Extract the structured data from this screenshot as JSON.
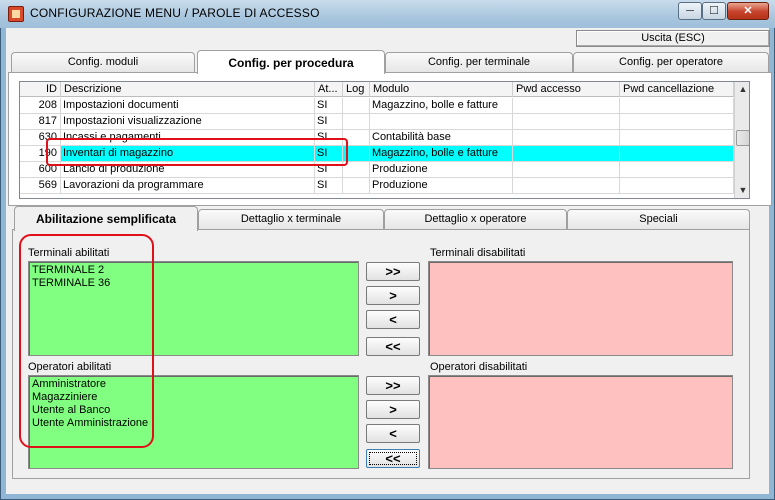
{
  "window": {
    "title": "CONFIGURAZIONE MENU / PAROLE DI ACCESSO",
    "min_glyph": "─",
    "max_glyph": "☐",
    "close_glyph": "✕",
    "icon": "app-icon"
  },
  "toolbar": {
    "exit_label": "Uscita (ESC)"
  },
  "top_tabs": [
    {
      "label": "Config. moduli",
      "active": false
    },
    {
      "label": "Config. per procedura",
      "active": true
    },
    {
      "label": "Config. per terminale",
      "active": false
    },
    {
      "label": "Config. per operatore",
      "active": false
    }
  ],
  "table": {
    "headers": [
      "ID",
      "Descrizione",
      "At...",
      "Log",
      "Modulo",
      "Pwd accesso",
      "Pwd cancellazione"
    ],
    "rows": [
      {
        "id": "208",
        "descrizione": "Impostazioni documenti",
        "attivo": "SI",
        "log": "",
        "modulo": "Magazzino, bolle e fatture",
        "selected": false
      },
      {
        "id": "817",
        "descrizione": "Impostazioni visualizzazione",
        "attivo": "SI",
        "log": "",
        "modulo": "",
        "selected": false
      },
      {
        "id": "630",
        "descrizione": "Incassi e pagamenti",
        "attivo": "SI",
        "log": "",
        "modulo": "Contabilità base",
        "selected": false
      },
      {
        "id": "190",
        "descrizione": "Inventari di magazzino",
        "attivo": "SI",
        "log": "",
        "modulo": "Magazzino, bolle e fatture",
        "selected": true
      },
      {
        "id": "600",
        "descrizione": "Lancio di produzione",
        "attivo": "SI",
        "log": "",
        "modulo": "Produzione",
        "selected": false
      },
      {
        "id": "569",
        "descrizione": "Lavorazioni da programmare",
        "attivo": "SI",
        "log": "",
        "modulo": "Produzione",
        "selected": false
      }
    ],
    "scroll_up": "▲",
    "scroll_down": "▼"
  },
  "bottom_tabs": [
    {
      "label": "Abilitazione semplificata",
      "active": true
    },
    {
      "label": "Dettaglio x terminale",
      "active": false
    },
    {
      "label": "Dettaglio x operatore",
      "active": false
    },
    {
      "label": "Speciali",
      "active": false
    }
  ],
  "terminals": {
    "enabled_label": "Terminali abilitati",
    "disabled_label": "Terminali disabilitati",
    "enabled": [
      "TERMINALE 2",
      "TERMINALE 36"
    ],
    "disabled": []
  },
  "operators": {
    "enabled_label": "Operatori abilitati",
    "disabled_label": "Operatori disabilitati",
    "enabled": [
      "Amministratore",
      "Magazziniere",
      "Utente al Banco",
      "Utente Amministrazione"
    ],
    "disabled": []
  },
  "move_buttons": {
    "all_right": ">>",
    "right": ">",
    "left": "<",
    "all_left": "<<"
  },
  "colors": {
    "selected_row": "#00ffff",
    "enabled_list": "#80ff80",
    "disabled_list": "#ffc0c0",
    "highlight": "#e0101a"
  }
}
